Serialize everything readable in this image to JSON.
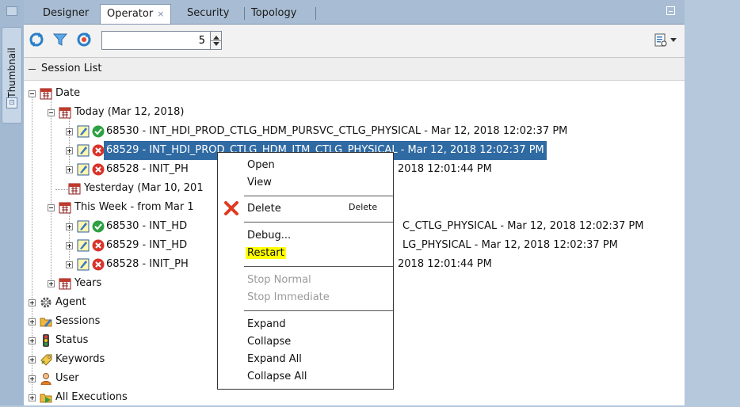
{
  "side_panel": {
    "thumbnail_label": "Thumbnail"
  },
  "tabs": [
    {
      "label": "Designer"
    },
    {
      "label": "Operator",
      "close": "×"
    },
    {
      "label": "Security"
    },
    {
      "label": "Topology"
    }
  ],
  "toolbar": {
    "spinner_value": "5"
  },
  "section": {
    "title": "Session List"
  },
  "tree": {
    "date": "Date",
    "today": "Today (Mar 12, 2018)",
    "today_sessions": [
      {
        "text": "68530 - INT_HDI_PROD_CTLG_HDM_PURSVC_CTLG_PHYSICAL - Mar 12, 2018 12:02:37 PM",
        "status": "success"
      },
      {
        "text": "68529 - INT_HDI_PROD_CTLG_HDM_ITM_CTLG_PHYSICAL - Mar 12, 2018 12:02:37 PM",
        "status": "error"
      },
      {
        "text_start": "68528 - INIT_PH",
        "text_end": "2018 12:01:44 PM",
        "status": "error"
      }
    ],
    "yesterday": "Yesterday (Mar 10, 201",
    "this_week": "This Week - from Mar 1",
    "week_sessions": [
      {
        "text_start": "68530 - INT_HD",
        "text_end": "C_CTLG_PHYSICAL - Mar 12, 2018 12:02:37 PM",
        "status": "success"
      },
      {
        "text_start": "68529 - INT_HD",
        "text_end": "LG_PHYSICAL - Mar 12, 2018 12:02:37 PM",
        "status": "error"
      },
      {
        "text_start": "68528 - INIT_PH",
        "text_end": "2018 12:01:44 PM",
        "status": "error"
      }
    ],
    "years": "Years",
    "roots": [
      "Agent",
      "Sessions",
      "Status",
      "Keywords",
      "User",
      "All Executions"
    ]
  },
  "context_menu": {
    "open": "Open",
    "view": "View",
    "delete": "Delete",
    "delete_accel": "Delete",
    "debug": "Debug...",
    "restart": "Restart",
    "stop_normal": "Stop Normal",
    "stop_immediate": "Stop Immediate",
    "expand": "Expand",
    "collapse": "Collapse",
    "expand_all": "Expand All",
    "collapse_all": "Collapse All"
  },
  "colors": {
    "selection": "#2f6aa3",
    "highlight": "#ffff00",
    "success": "#2ea043",
    "error": "#d9342b"
  }
}
